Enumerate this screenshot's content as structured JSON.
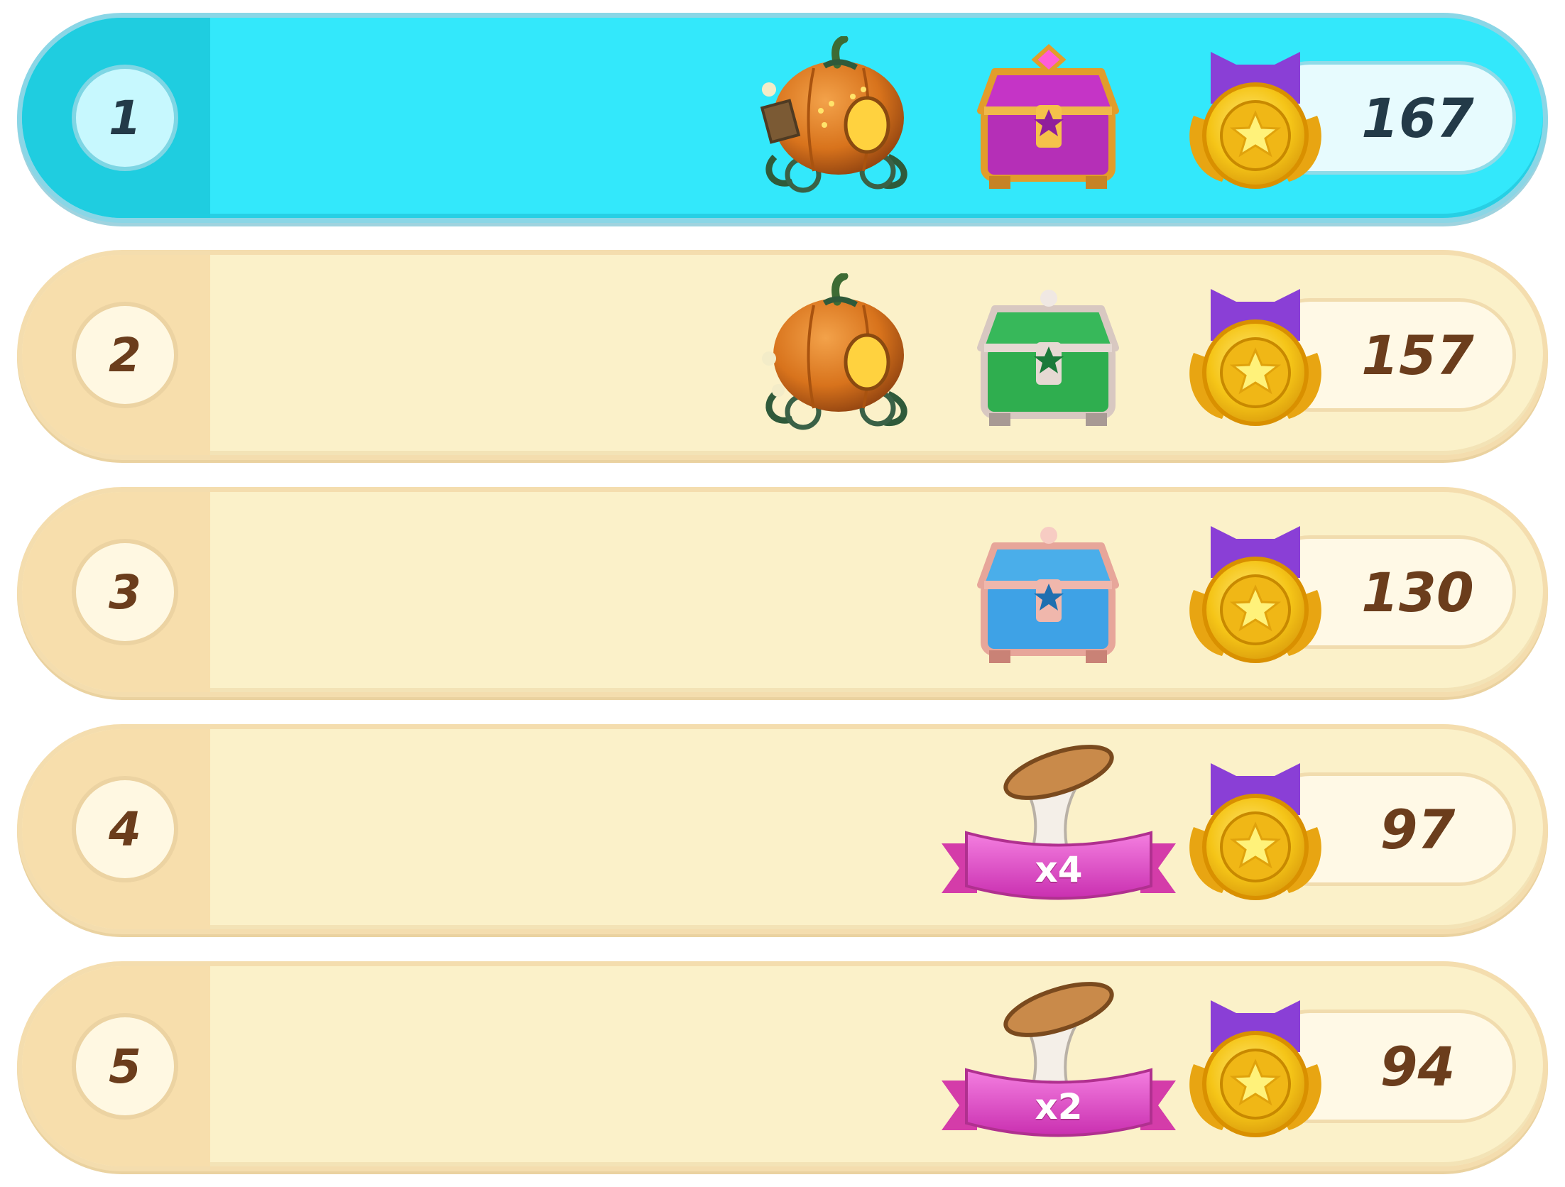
{
  "leaderboard": {
    "rows": [
      {
        "rank": "1",
        "score": "167",
        "highlighted": true,
        "rewards": [
          "pumpkin-carriage-icon",
          "purple-chest-icon"
        ]
      },
      {
        "rank": "2",
        "score": "157",
        "highlighted": false,
        "rewards": [
          "pumpkin-carriage-icon",
          "green-chest-icon"
        ]
      },
      {
        "rank": "3",
        "score": "130",
        "highlighted": false,
        "rewards": [
          "blue-chest-icon"
        ]
      },
      {
        "rank": "4",
        "score": "97",
        "highlighted": false,
        "rewards": [
          "hourglass-icon"
        ],
        "multiplier": "x4"
      },
      {
        "rank": "5",
        "score": "94",
        "highlighted": false,
        "rewards": [
          "hourglass-icon"
        ],
        "multiplier": "x2"
      }
    ]
  },
  "colors": {
    "highlight_row": "#33e8fb",
    "row_background": "#fbf1c9",
    "rank_panel": "#f7deac",
    "text_brown": "#6b3d1c",
    "text_dark": "#233a48",
    "ribbon_pink": "#e64fc4",
    "medal_ribbon": "#8a3fd6",
    "medal_gold": "#f5c518",
    "chest_purple": "#c534c6",
    "chest_green": "#2fae4f",
    "chest_blue": "#3ea2e6"
  },
  "icons": {
    "medal": "star-medal-icon",
    "hourglass": "hourglass-icon",
    "pumpkin": "pumpkin-carriage-icon"
  }
}
